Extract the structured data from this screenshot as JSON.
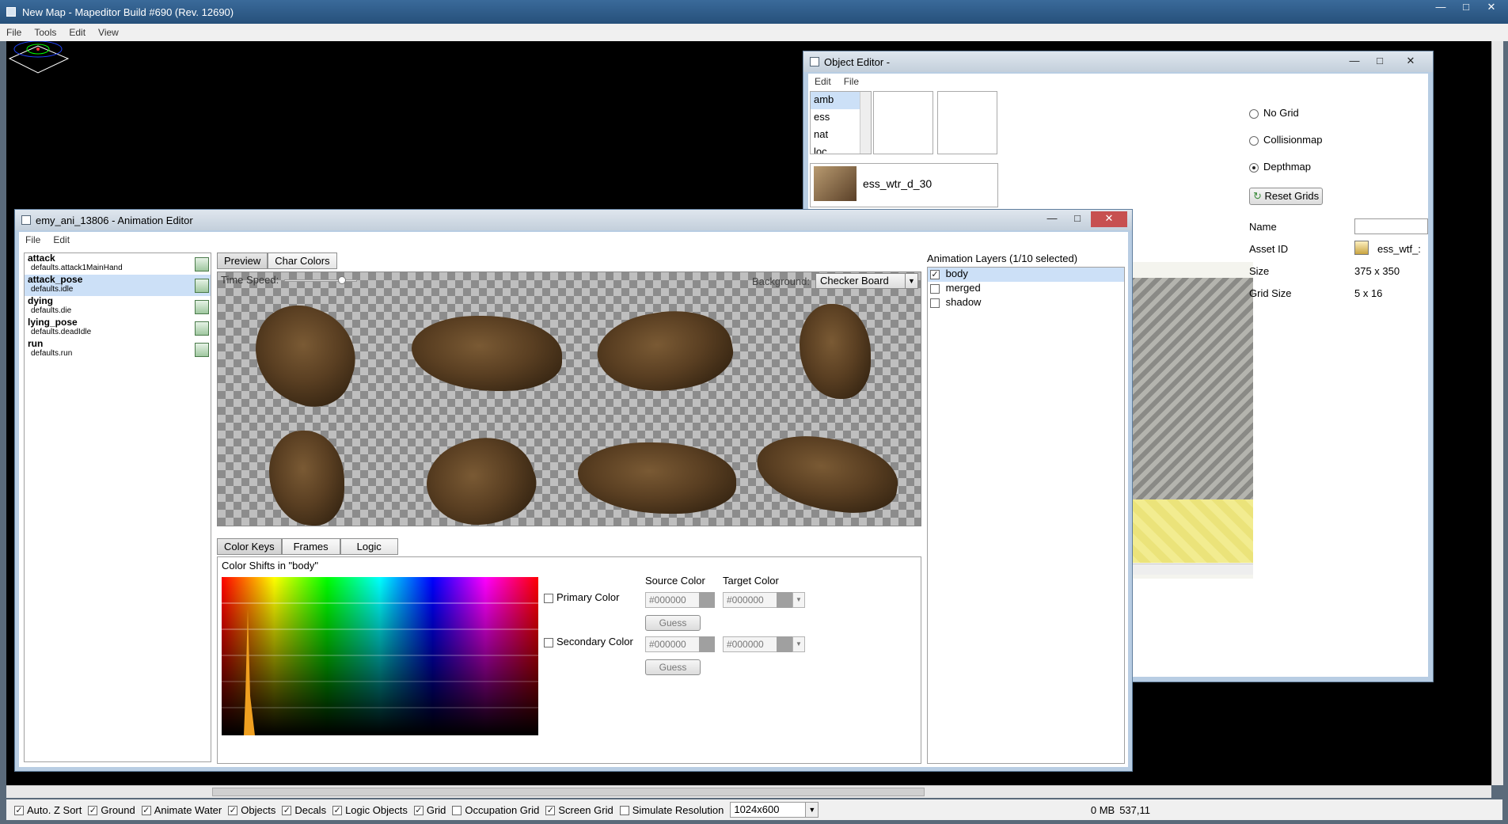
{
  "main_window": {
    "title": "New Map - Mapeditor Build #690 (Rev. 12690)",
    "menu": [
      "File",
      "Tools",
      "Edit",
      "View"
    ]
  },
  "object_editor": {
    "title": "Object Editor -",
    "menu": [
      "Edit",
      "File"
    ],
    "categories": [
      "amb",
      "ess",
      "nat",
      "loc"
    ],
    "asset_item": "ess_wtr_d_30",
    "radios": [
      {
        "label": "No Grid",
        "selected": false
      },
      {
        "label": "Collisionmap",
        "selected": false
      },
      {
        "label": "Depthmap",
        "selected": true
      }
    ],
    "reset_button": "Reset Grids",
    "props": {
      "name_label": "Name",
      "name_value": "",
      "asset_id_label": "Asset ID",
      "asset_id_value": "ess_wtf_:",
      "size_label": "Size",
      "size_value": "375 x 350",
      "grid_size_label": "Grid Size",
      "grid_size_value": "5 x 16"
    }
  },
  "anim_editor": {
    "title": "emy_ani_13806 - Animation Editor",
    "menu": [
      "File",
      "Edit"
    ],
    "animations": [
      {
        "name": "attack",
        "sub": "defaults.attack1MainHand",
        "selected": false
      },
      {
        "name": "attack_pose",
        "sub": "defaults.idle",
        "selected": true
      },
      {
        "name": "dying",
        "sub": "defaults.die",
        "selected": false
      },
      {
        "name": "lying_pose",
        "sub": "defaults.deadIdle",
        "selected": false
      },
      {
        "name": "run",
        "sub": "defaults.run",
        "selected": false
      }
    ],
    "preview_tabs": [
      "Preview",
      "Char Colors"
    ],
    "time_speed_label": "Time Speed:",
    "time_speed_value": 0.8,
    "background_label": "Background:",
    "background_value": "Checker Board",
    "bottom_tabs": [
      "Color Keys",
      "Frames",
      "Logic"
    ],
    "color_shifts_label": "Color Shifts in \"body\"",
    "source_color_label": "Source Color",
    "target_color_label": "Target Color",
    "primary_label": "Primary Color",
    "secondary_label": "Secondary Color",
    "primary_source": "#000000",
    "primary_target": "#000000",
    "secondary_source": "#000000",
    "secondary_target": "#000000",
    "guess_label": "Guess",
    "layers_title": "Animation Layers (1/10 selected)",
    "layers": [
      {
        "name": "body",
        "checked": true
      },
      {
        "name": "merged",
        "checked": false
      },
      {
        "name": "shadow",
        "checked": false
      }
    ]
  },
  "statusbar": {
    "toggles": [
      {
        "label": "Auto. Z Sort",
        "checked": true
      },
      {
        "label": "Ground",
        "checked": true
      },
      {
        "label": "Animate Water",
        "checked": true
      },
      {
        "label": "Objects",
        "checked": true
      },
      {
        "label": "Decals",
        "checked": true
      },
      {
        "label": "Logic Objects",
        "checked": true
      },
      {
        "label": "Grid",
        "checked": true
      },
      {
        "label": "Occupation Grid",
        "checked": false
      },
      {
        "label": "Screen Grid",
        "checked": true
      },
      {
        "label": "Simulate Resolution",
        "checked": false
      }
    ],
    "resolution": "1024x600",
    "memory": "0 MB",
    "coords": "537,11"
  },
  "colors": {
    "selection": "#cce0f7",
    "accent_blue": "#3c78c8",
    "orange_peak": "#f0a020"
  }
}
